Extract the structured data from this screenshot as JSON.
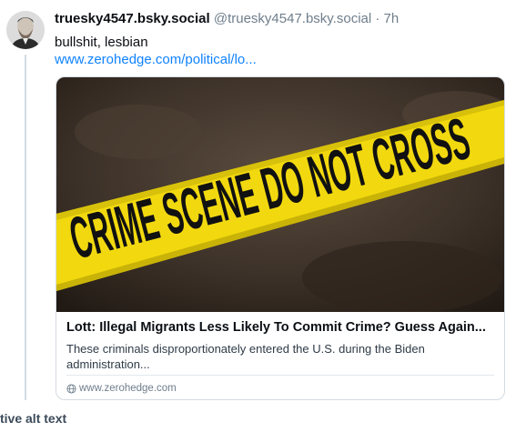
{
  "post": {
    "display_handle": "truesky4547.bsky.social",
    "handle": "@truesky4547.bsky.social",
    "separator": "·",
    "time": "7h",
    "text": "bullshit, lesbian",
    "link_text": "www.zerohedge.com/political/lo..."
  },
  "embed_card": {
    "image_text": "CRIME SCENE DO NOT CROSS",
    "title": "Lott: Illegal Migrants Less Likely To Commit Crime? Guess Again...",
    "description": "These criminals disproportionately entered the U.S. during the Biden administration...",
    "domain": "www.zerohedge.com"
  },
  "footer": {
    "alt_text_label": "tive alt text"
  },
  "colors": {
    "link": "#1083fe",
    "tape_yellow": "#f2d90f",
    "muted": "#6f7e8c"
  },
  "icons": [
    "avatar",
    "globe-icon"
  ]
}
